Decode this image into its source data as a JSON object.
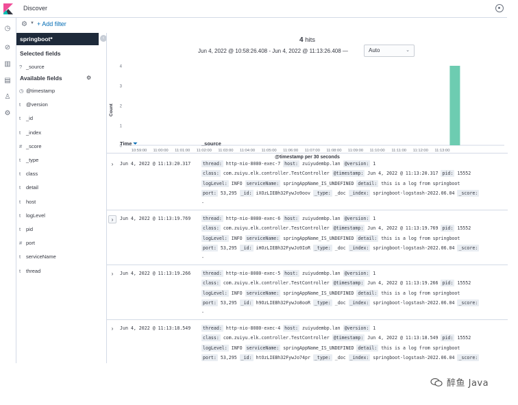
{
  "header": {
    "title": "Discover"
  },
  "filter": {
    "add_label": "+ Add filter"
  },
  "sidebar": {
    "index_pattern": "springboot*",
    "selected_heading": "Selected fields",
    "selected_fields": [
      {
        "type": "?",
        "name": "_source"
      }
    ],
    "available_heading": "Available fields",
    "available_fields": [
      {
        "type": "◷",
        "name": "@timestamp"
      },
      {
        "type": "t",
        "name": "@version"
      },
      {
        "type": "t",
        "name": "_id"
      },
      {
        "type": "t",
        "name": "_index"
      },
      {
        "type": "#",
        "name": "_score"
      },
      {
        "type": "t",
        "name": "_type"
      },
      {
        "type": "t",
        "name": "class"
      },
      {
        "type": "t",
        "name": "detail"
      },
      {
        "type": "t",
        "name": "host"
      },
      {
        "type": "t",
        "name": "logLevel"
      },
      {
        "type": "t",
        "name": "pid"
      },
      {
        "type": "#",
        "name": "port"
      },
      {
        "type": "t",
        "name": "serviceName"
      },
      {
        "type": "t",
        "name": "thread"
      }
    ]
  },
  "results": {
    "hits_count": "4",
    "hits_label": "hits",
    "time_range": "Jun 4, 2022 @ 10:58:26.408 - Jun 4, 2022 @ 11:13:26.408 —",
    "interval": "Auto"
  },
  "chart_data": {
    "type": "bar",
    "ylabel": "Count",
    "xlabel": "@timestamp per 30 seconds",
    "yticks": [
      0,
      1,
      2,
      3,
      4
    ],
    "ylim": [
      0,
      4
    ],
    "xticks": [
      "10:59:00",
      "11:00:00",
      "11:01:00",
      "11:02:00",
      "11:03:00",
      "11:04:00",
      "11:05:00",
      "11:06:00",
      "11:07:00",
      "11:08:00",
      "11:09:00",
      "11:10:00",
      "11:11:00",
      "11:12:00",
      "11:13:00"
    ],
    "bars": [
      {
        "x": "11:13:00",
        "value": 4
      }
    ],
    "bar_color": "#6dccb1",
    "grid": false
  },
  "table": {
    "col_time": "Time",
    "col_source": "_source",
    "rows": [
      {
        "time": "Jun 4, 2022 @ 11:13:20.317",
        "thread": "http-nio-8080-exec-7",
        "host": "zuiyudembp.lan",
        "version": "1",
        "class": "com.zuiyu.elk.controller.TestController",
        "timestamp": "Jun 4, 2022 @ 11:13:20.317",
        "pid": "15552",
        "logLevel": "INFO",
        "serviceName": "springAppName_IS_UNDEFINED",
        "detail": "this is a log from springboot",
        "port": "53,295",
        "id": "iXOzLIEBh32FywJo9oov",
        "type": "_doc",
        "index": "springboot-logstash-2022.06.04",
        "score": "-"
      },
      {
        "time": "Jun 4, 2022 @ 11:13:19.769",
        "thread": "http-nio-8080-exec-6",
        "host": "zuiyudembp.lan",
        "version": "1",
        "class": "com.zuiyu.elk.controller.TestController",
        "timestamp": "Jun 4, 2022 @ 11:13:19.769",
        "pid": "15552",
        "logLevel": "INFO",
        "serviceName": "springAppName_IS_UNDEFINED",
        "detail": "this is a log from springboot",
        "port": "53,295",
        "id": "iHOzLIEBh32FywJo9IoR",
        "type": "_doc",
        "index": "springboot-logstash-2022.06.04",
        "score": "-"
      },
      {
        "time": "Jun 4, 2022 @ 11:13:19.266",
        "thread": "http-nio-8080-exec-5",
        "host": "zuiyudembp.lan",
        "version": "1",
        "class": "com.zuiyu.elk.controller.TestController",
        "timestamp": "Jun 4, 2022 @ 11:13:19.266",
        "pid": "15552",
        "logLevel": "INFO",
        "serviceName": "springAppName_IS_UNDEFINED",
        "detail": "this is a log from springboot",
        "port": "53,295",
        "id": "h9OzLIEBh32FywJo8ooR",
        "type": "_doc",
        "index": "springboot-logstash-2022.06.04",
        "score": "-"
      },
      {
        "time": "Jun 4, 2022 @ 11:13:18.549",
        "thread": "http-nio-8080-exec-4",
        "host": "zuiyudembp.lan",
        "version": "1",
        "class": "com.zuiyu.elk.controller.TestController",
        "timestamp": "Jun 4, 2022 @ 11:13:18.549",
        "pid": "15552",
        "logLevel": "INFO",
        "serviceName": "springAppName_IS_UNDEFINED",
        "detail": "this is a log from springboot",
        "port": "53,295",
        "id": "htOzLIEBh32FywJo74pr",
        "type": "_doc",
        "index": "springboot-logstash-2022.06.04",
        "score": "-"
      }
    ]
  },
  "watermark": {
    "text": "醉鱼 Java"
  }
}
